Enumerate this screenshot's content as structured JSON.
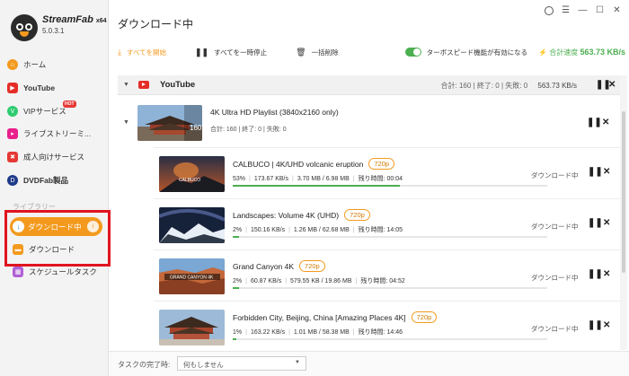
{
  "app": {
    "brand": "StreamFab",
    "arch": "x64",
    "version": "5.0.3.1"
  },
  "sidebar": {
    "items": [
      {
        "label": "ホーム",
        "icon": "home-icon",
        "color": "#f39a1e"
      },
      {
        "label": "YouTube",
        "icon": "youtube-icon",
        "color": "#e52d27"
      },
      {
        "label": "VIPサービス",
        "icon": "vip-icon",
        "color": "#2ecc71",
        "badge": "HOT"
      },
      {
        "label": "ライブストリーミ...",
        "icon": "live-stream-icon",
        "color": "#e91e8c"
      },
      {
        "label": "成人向けサービス",
        "icon": "adult-service-icon",
        "color": "#e53935"
      },
      {
        "label": "DVDFab製品",
        "icon": "dvdfab-icon",
        "color": "#1e3a8a"
      }
    ],
    "library_label": "ライブラリー",
    "library": [
      {
        "label": "ダウンロード中",
        "icon": "downloading-icon"
      },
      {
        "label": "ダウンロード",
        "icon": "folder-icon"
      },
      {
        "label": "スケジュールタスク",
        "icon": "schedule-icon"
      }
    ]
  },
  "header": {
    "title": "ダウンロード中"
  },
  "toolbar": {
    "start_all": "すべてを開始",
    "pause_all": "すべてを一時停止",
    "delete_all": "一括削除",
    "turbo_label": "ターボスピード機能が有効になる",
    "total_speed_label": "合計速度",
    "total_speed_value": "563.73 KB/s"
  },
  "group": {
    "title": "YouTube",
    "total": "合計: 160",
    "finished": "終了: 0",
    "failed": "失敗: 0",
    "speed": "563.73 KB/s"
  },
  "playlist": {
    "title": "4K Ultra HD Playlist (3840x2160 only)",
    "count_badge": "160",
    "total": "合計: 160",
    "finished": "終了: 0",
    "failed": "失敗: 0"
  },
  "rows": [
    {
      "title": "CALBUCO | 4K/UHD volcanic eruption",
      "quality": "720p",
      "percent": "53%",
      "speed": "173.67 KB/s",
      "size": "3.70 MB / 6.98 MB",
      "remaining_label": "残り時間:",
      "remaining": "00:04",
      "progress": 0.53,
      "status": "ダウンロード中"
    },
    {
      "title": "Landscapes: Volume 4K (UHD)",
      "quality": "720p",
      "percent": "2%",
      "speed": "150.16 KB/s",
      "size": "1.26 MB / 62.68 MB",
      "remaining_label": "残り時間:",
      "remaining": "14:05",
      "progress": 0.02,
      "status": "ダウンロード中"
    },
    {
      "title": "Grand Canyon 4K",
      "quality": "720p",
      "percent": "2%",
      "speed": "60.87 KB/s",
      "size": "579.55 KB / 19.86 MB",
      "remaining_label": "残り時間:",
      "remaining": "04:52",
      "progress": 0.02,
      "status": "ダウンロード中"
    },
    {
      "title": "Forbidden City, Beijing, China  [Amazing Places 4K]",
      "quality": "720p",
      "percent": "1%",
      "speed": "163.22 KB/s",
      "size": "1.01 MB / 58.38 MB",
      "remaining_label": "残り時間:",
      "remaining": "14:46",
      "progress": 0.01,
      "status": "ダウンロード中"
    }
  ],
  "thumbs": {
    "calbuco_text": "CALBUCO",
    "grand_canyon_text": "GRAND CANYON 4K"
  },
  "footer": {
    "label": "タスクの完了時:",
    "select_value": "何もしません"
  },
  "colors": {
    "accent": "#f39a1e",
    "green": "#4caf50",
    "highlight": "#e0141e"
  }
}
